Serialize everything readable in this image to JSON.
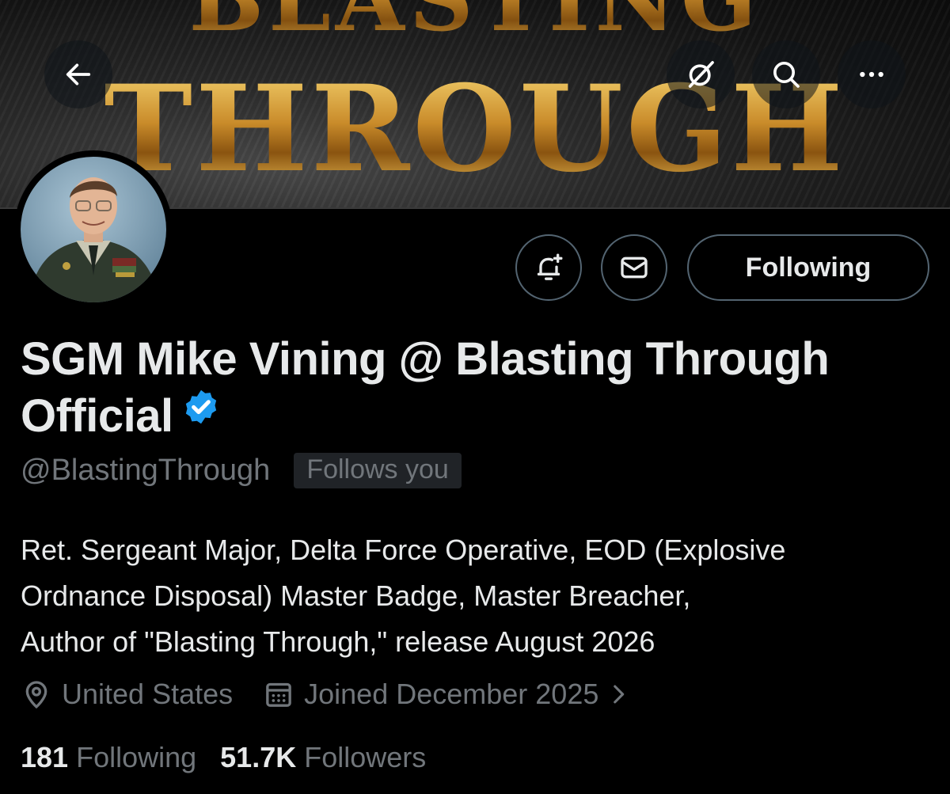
{
  "banner": {
    "word_top": "BLASTING",
    "word_main": "THROUGH"
  },
  "header": {
    "back_icon": "arrow-left-icon",
    "grok_icon": "grok-icon",
    "search_icon": "search-icon",
    "more_icon": "more-horizontal-icon"
  },
  "actions": {
    "notify_icon": "bell-plus-icon",
    "message_icon": "envelope-icon",
    "follow_label": "Following"
  },
  "profile": {
    "name_line1": "SGM Mike Vining @ Blasting Through",
    "name_line2": "Official",
    "verified_icon": "verified-badge-icon",
    "handle": "@BlastingThrough",
    "follows_you": "Follows you",
    "bio_line1": "Ret. Sergeant Major, Delta Force Operative, EOD (Explosive",
    "bio_line2": "Ordnance Disposal) Master Badge, Master Breacher,",
    "bio_line3": "Author of \"Blasting Through,\" release August 2026",
    "location": "United States",
    "joined": "Joined December 2025"
  },
  "stats": {
    "following_count": "181",
    "following_label": "Following",
    "followers_count": "51.7K",
    "followers_label": "Followers"
  },
  "colors": {
    "background": "#000000",
    "text_primary": "#e7e9ea",
    "text_secondary": "#71767b",
    "border": "#536471",
    "verified_blue": "#1d9bf0",
    "banner_gold": "#c9902b"
  }
}
